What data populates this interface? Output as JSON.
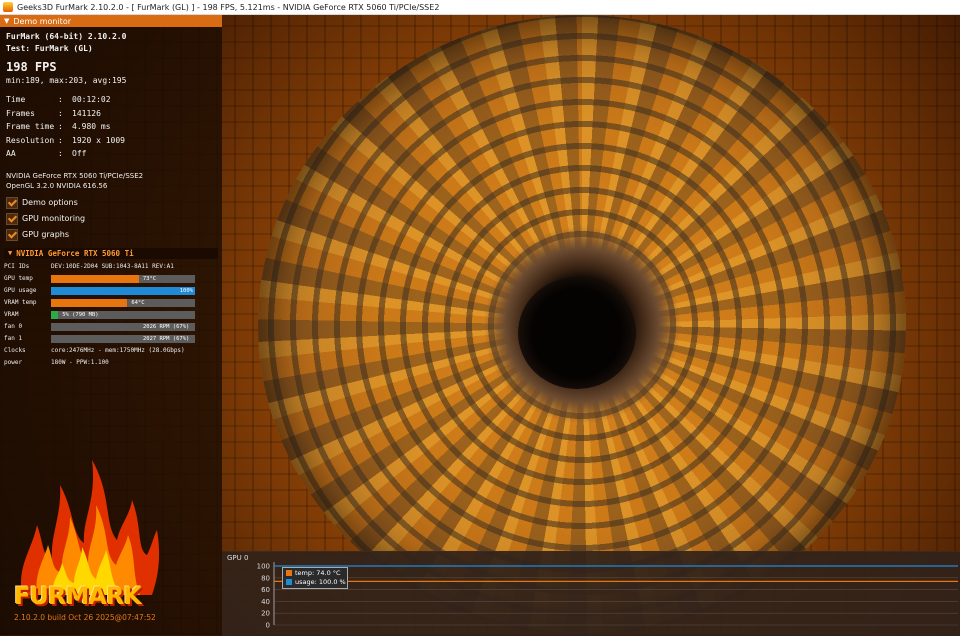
{
  "window": {
    "title": "Geeks3D FurMark 2.10.2.0 - [ FurMark (GL) ] - 198 FPS, 5.121ms - NVIDIA GeForce RTX 5060 Ti/PCIe/SSE2"
  },
  "panel": {
    "header": "Demo monitor",
    "version": "FurMark (64-bit) 2.10.2.0",
    "test": "Test: FurMark (GL)",
    "fps": "198 FPS",
    "minmax": "min:189, max:203, avg:195",
    "stats": [
      {
        "label": "Time",
        "value": "00:12:02"
      },
      {
        "label": "Frames",
        "value": "141126"
      },
      {
        "label": "Frame time",
        "value": "4.980 ms"
      },
      {
        "label": "Resolution",
        "value": "1920 x 1009"
      },
      {
        "label": "AA",
        "value": "Off"
      }
    ],
    "renderer": "NVIDIA GeForce RTX 5060 Ti/PCIe/SSE2",
    "opengl": "OpenGL 3.2.0 NVIDIA 616.56",
    "options": [
      {
        "label": "Demo options",
        "checked": true
      },
      {
        "label": "GPU monitoring",
        "checked": true
      },
      {
        "label": "GPU graphs",
        "checked": true
      }
    ]
  },
  "gpu": {
    "header": "NVIDIA GeForce RTX 5060 Ti",
    "pci_label": "PCI IDs",
    "pci_value": "DEV:10DE-2D04 SUB:1043-8A11 REV:A1",
    "temp": {
      "label": "GPU temp",
      "value": "73°C",
      "fraction": 0.61,
      "color": "#e8760f"
    },
    "usage": {
      "label": "GPU usage",
      "value": "100%",
      "fraction": 1.0,
      "color": "#1f8ad6"
    },
    "vram_temp": {
      "label": "VRAM temp",
      "value": "64°C",
      "fraction": 0.53,
      "color": "#e8760f"
    },
    "vram": {
      "label": "VRAM",
      "value": "5% (790 MB)",
      "fraction": 0.05,
      "color": "#2fa84a"
    },
    "fan0": {
      "label": "fan 0",
      "value": "2026 RPM (67%)"
    },
    "fan1": {
      "label": "fan 1",
      "value": "2027 RPM (67%)"
    },
    "clocks_label": "Clocks",
    "clocks_value": "core:2476MHz - mem:1750MHz (28.0Gbps)",
    "power_label": "power",
    "power_value": "180W - PPW:1.100"
  },
  "logo": {
    "text": "FURMARK",
    "build": "2.10.2.0 build Oct 26 2025@07:47:52"
  },
  "graph": {
    "title": "GPU 0",
    "y_ticks": [
      "100",
      "80",
      "60",
      "40",
      "20",
      "0"
    ],
    "legend_temp": "temp: 74.0 °C",
    "legend_usage": "usage: 100.0 %",
    "temp_color": "#e8760f",
    "usage_color": "#1f8ad6"
  },
  "chart_data": {
    "type": "line",
    "ylim": [
      0,
      100
    ],
    "series": [
      {
        "name": "temp",
        "values": [
          74,
          74,
          74,
          74,
          74,
          74,
          74,
          74
        ]
      },
      {
        "name": "usage",
        "values": [
          100,
          100,
          100,
          100,
          100,
          100,
          100,
          100
        ]
      }
    ]
  }
}
